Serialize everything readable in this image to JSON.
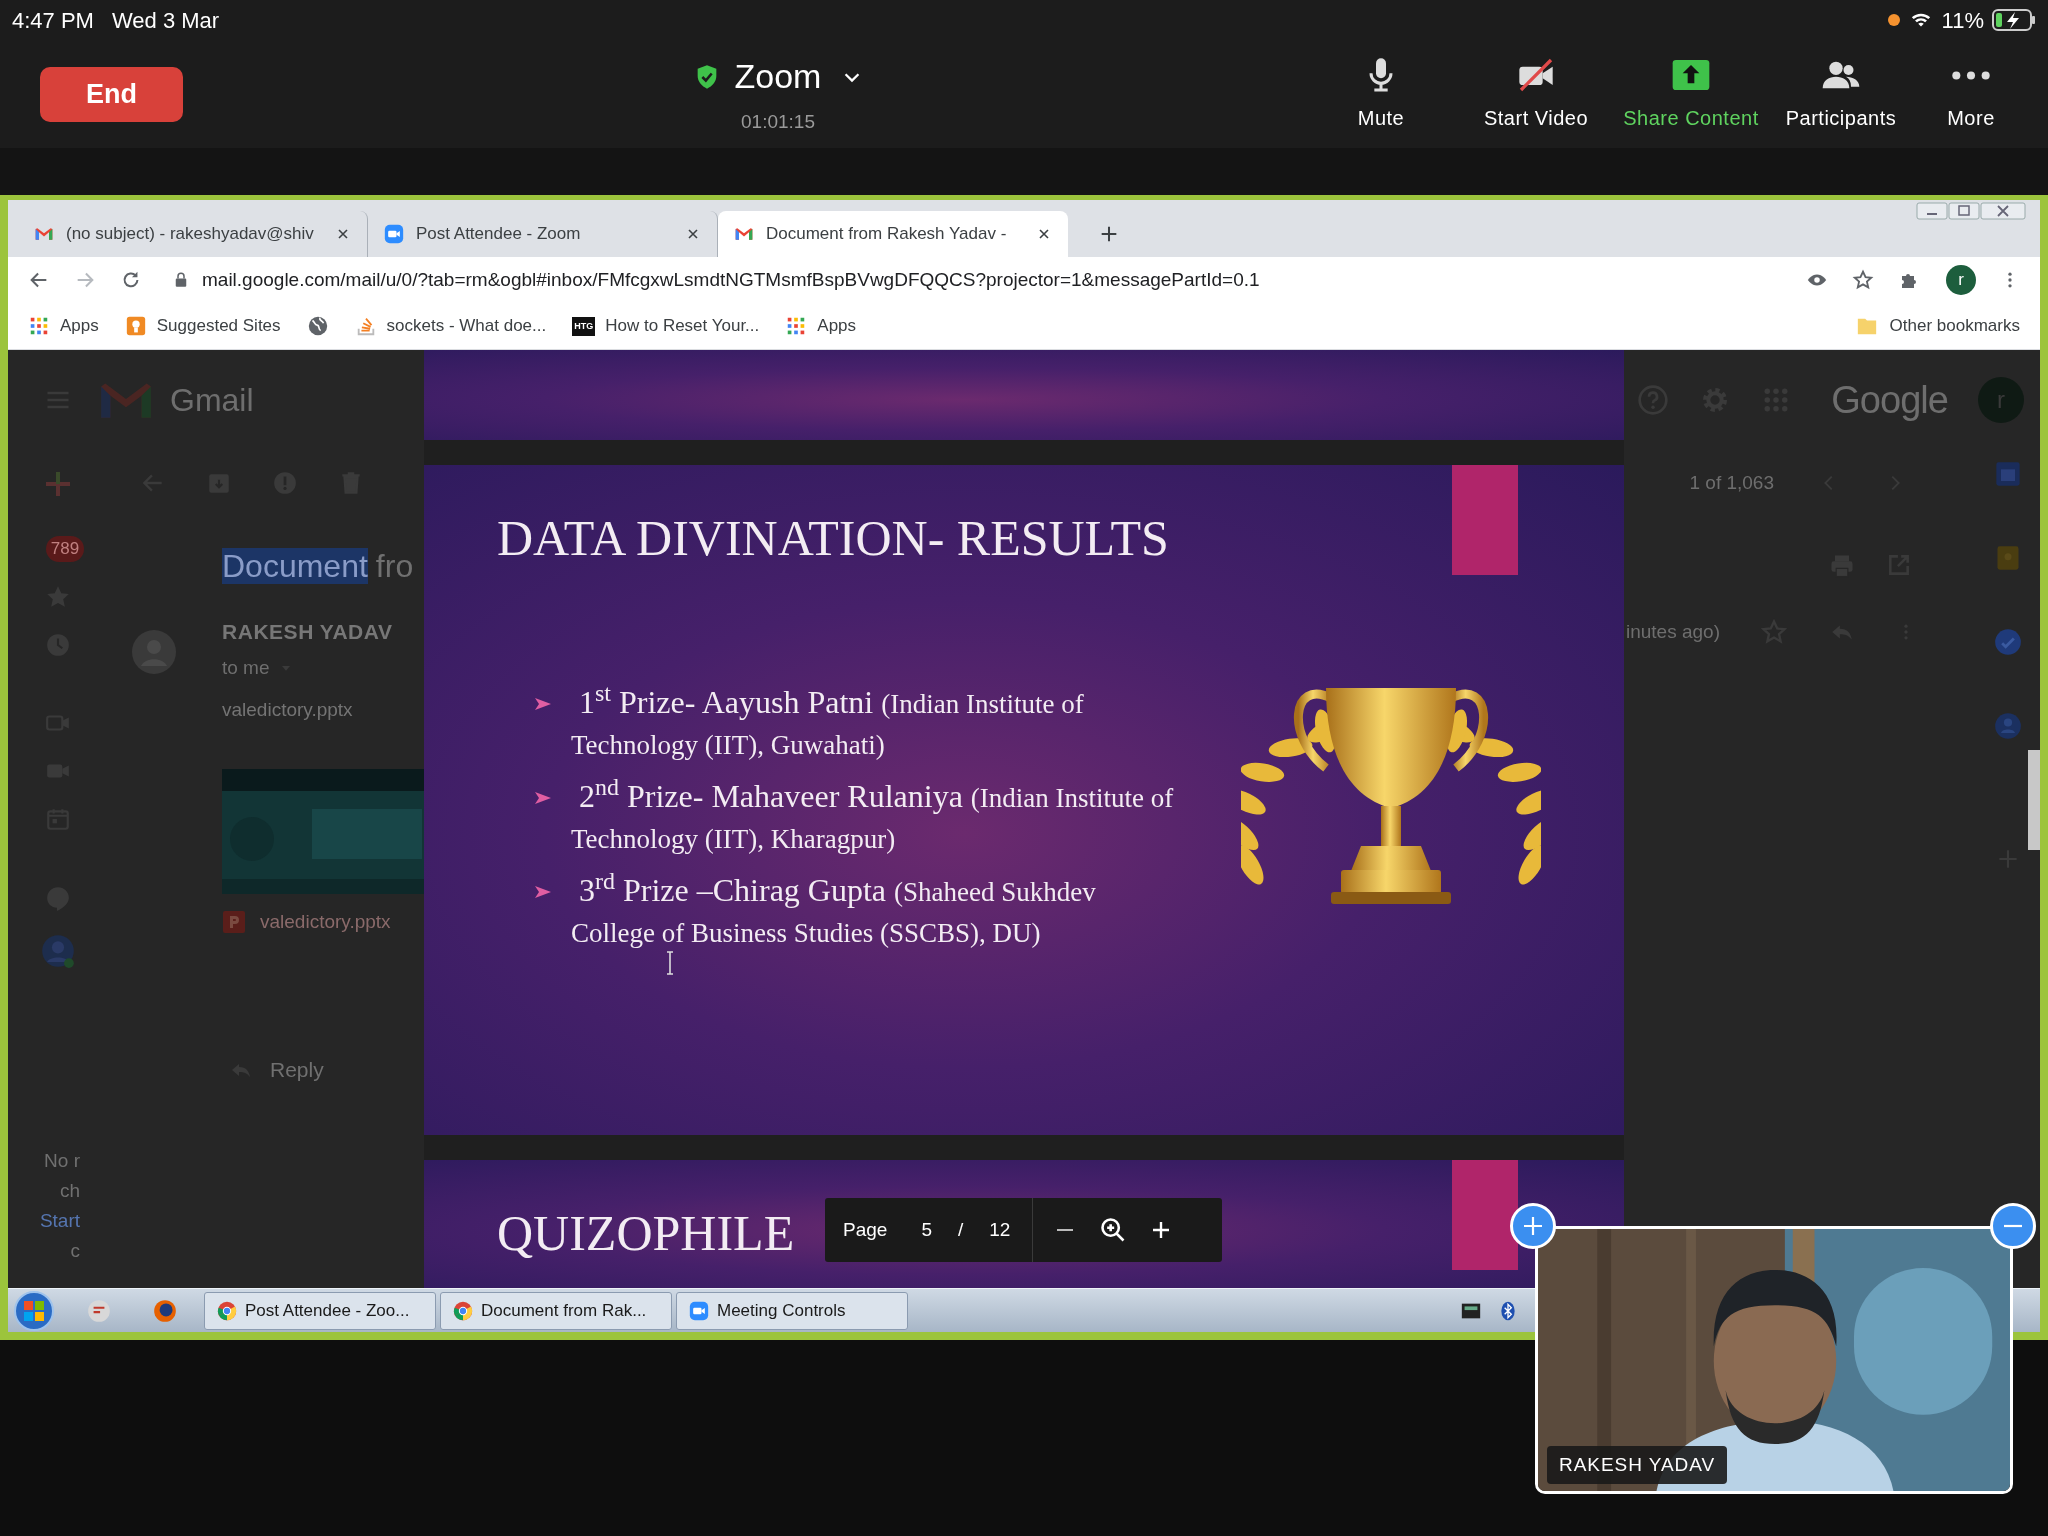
{
  "status_bar": {
    "time": "4:47 PM",
    "date": "Wed 3 Mar",
    "battery": "11%"
  },
  "meeting_bar": {
    "end_button": "End",
    "title": "Zoom",
    "elapsed": "01:01:15",
    "controls": [
      {
        "kind": "mic",
        "label": "Mute"
      },
      {
        "kind": "video_off",
        "label": "Start Video"
      },
      {
        "kind": "share",
        "label": "Share Content"
      },
      {
        "kind": "participants",
        "label": "Participants"
      },
      {
        "kind": "more",
        "label": "More"
      }
    ]
  },
  "browser": {
    "tabs": [
      {
        "kind": "gmail",
        "label": "(no subject) - rakeshyadav@shiv",
        "selected": false
      },
      {
        "kind": "zoom",
        "label": "Post Attendee - Zoom",
        "selected": false
      },
      {
        "kind": "gmail",
        "label": "Document from Rakesh Yadav - ",
        "selected": true
      }
    ],
    "url": "mail.google.com/mail/u/0/?tab=rm&ogbl#inbox/FMfcgxwLsmdtNGTMsmfBspBVwgDFQQCS?projector=1&messagePartId=0.1",
    "profile": "r",
    "bookmarks": [
      {
        "kind": "apps",
        "label": "Apps"
      },
      {
        "kind": "suggested",
        "label": "Suggested Sites"
      },
      {
        "kind": "globe"
      },
      {
        "kind": "stack",
        "label": "sockets - What doe..."
      },
      {
        "kind": "badge",
        "badge": "HTG",
        "label": "How to Reset Your..."
      },
      {
        "kind": "apps",
        "label": "Apps"
      }
    ],
    "other_bookmarks": "Other bookmarks"
  },
  "gmail": {
    "brand": "Gmail",
    "unread": "789",
    "subject": [
      {
        "text": "Document",
        "selected": true
      },
      {
        "text": "fro",
        "selected": false
      }
    ],
    "sender": "RAKESH YADAV",
    "recipient": "to me",
    "filename": "valedictory.pptx",
    "attachment_name": "valedictory.pptx",
    "reply": "Reply",
    "counter": "1 of 1,063",
    "time": "inutes ago)",
    "google": "Google",
    "avatar": "r",
    "rail_lines": [
      {
        "text": "No r",
        "link": false
      },
      {
        "text": "ch",
        "link": false
      },
      {
        "text": "Start",
        "link": true
      },
      {
        "text": "c",
        "link": false
      }
    ]
  },
  "viewer": {
    "slide": {
      "title": "DATA DIVINATION- RESULTS",
      "bullets": [
        {
          "prize": "1$^{st}$ Prize- Aayush Patni",
          "detail": [
            "(Indian Institute of",
            "Technology (IIT), Guwahati)"
          ]
        },
        {
          "prize": "2$^{nd}$ Prize- Mahaveer Rulaniya",
          "detail": [
            "(Indian Institute of",
            "Technology (IIT), Kharagpur)"
          ]
        },
        {
          "prize": "3$^{rd}$ Prize –Chirag Gupta",
          "detail": [
            "(Shaheed Sukhdev",
            "College of Business Studies (SSCBS), DU)"
          ]
        }
      ]
    },
    "next_slide": {
      "title": "QUIZOPHILE"
    },
    "pager": {
      "label": "Page",
      "page": "5",
      "separator": "/",
      "total": "12"
    }
  },
  "taskbar": {
    "tasks": [
      {
        "kind": "chrome",
        "label": "Post Attendee - Zoo..."
      },
      {
        "kind": "chrome",
        "label": "Document from Rak..."
      },
      {
        "kind": "zoom",
        "label": "Meeting Controls"
      }
    ]
  },
  "video": {
    "name": "RAKESH YADAV"
  }
}
